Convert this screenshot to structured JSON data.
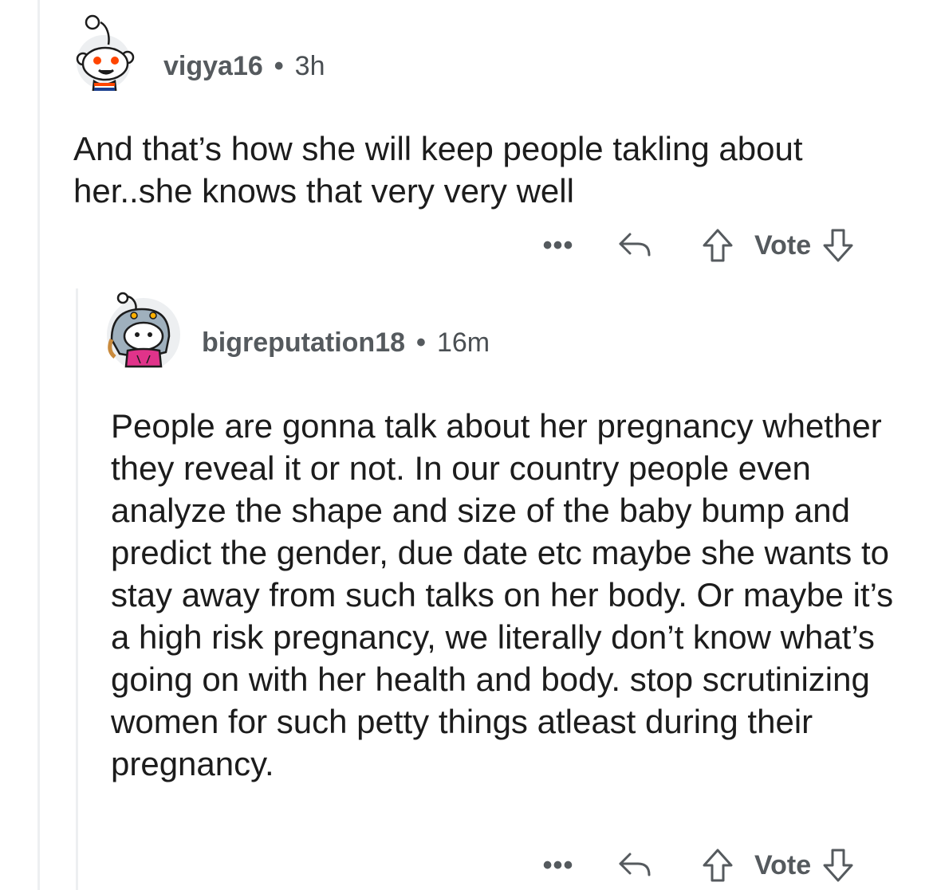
{
  "comments": [
    {
      "username": "vigya16",
      "separator": "•",
      "time": "3h",
      "avatar_icon": "snoo-avatar-icon",
      "body": "And that’s how she will keep people takling about her..she knows that very very well",
      "actions": {
        "more_label": "•••",
        "reply_icon": "reply-icon",
        "upvote_icon": "upvote-arrow-icon",
        "vote_label": "Vote",
        "downvote_icon": "downvote-arrow-icon"
      }
    },
    {
      "username": "bigreputation18",
      "separator": "•",
      "time": "16m",
      "avatar_icon": "snoo-avatar-icon",
      "body": "People are gonna talk about her pregnancy whether they reveal it or not. In our country people even analyze the shape and size of the baby bump and predict the gender, due date etc maybe she wants to stay away from such talks on her body. Or maybe it’s a high risk pregnancy, we literally don’t know what’s going on with her health and body. stop scrutinizing women for such petty things atleast during their pregnancy.",
      "actions": {
        "more_label": "•••",
        "reply_icon": "reply-icon",
        "upvote_icon": "upvote-arrow-icon",
        "vote_label": "Vote",
        "downvote_icon": "downvote-arrow-icon"
      }
    }
  ],
  "colors": {
    "accent_orange": "#ff4500",
    "meta_text": "#555a5e",
    "thread_line": "#edeff1",
    "avatar_bg": "#edeff1",
    "avatar_hoodie": "#e0338a"
  }
}
